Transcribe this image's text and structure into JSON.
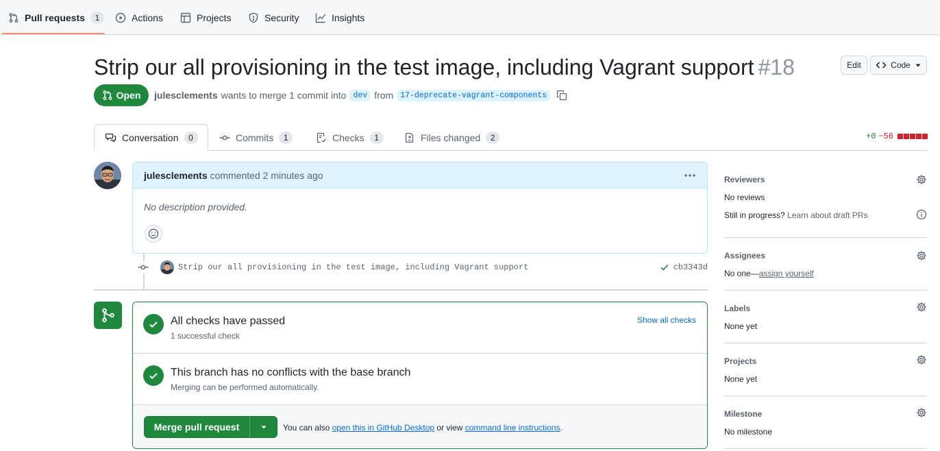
{
  "repo_nav": {
    "items": [
      {
        "label": "Pull requests",
        "count": "1"
      },
      {
        "label": "Actions"
      },
      {
        "label": "Projects"
      },
      {
        "label": "Security"
      },
      {
        "label": "Insights"
      }
    ]
  },
  "pr": {
    "title": "Strip our all provisioning in the test image, including Vagrant support",
    "number": "#18",
    "state": "Open",
    "author": "julesclements",
    "merge_text": "wants to merge 1 commit into",
    "base_branch": "dev",
    "from_text": "from",
    "head_branch": "17-deprecate-vagrant-components"
  },
  "header_buttons": {
    "edit": "Edit",
    "code": "Code"
  },
  "tabs": [
    {
      "label": "Conversation",
      "count": "0"
    },
    {
      "label": "Commits",
      "count": "1"
    },
    {
      "label": "Checks",
      "count": "1"
    },
    {
      "label": "Files changed",
      "count": "2"
    }
  ],
  "diffstat": {
    "additions": "+0",
    "deletions": "−56"
  },
  "comment": {
    "author": "julesclements",
    "action": "commented 2 minutes ago",
    "body": "No description provided."
  },
  "commit": {
    "message": "Strip our all provisioning in the test image, including Vagrant support",
    "sha": "cb3343d"
  },
  "merge_box": {
    "checks_title": "All checks have passed",
    "checks_sub": "1 successful check",
    "show_checks": "Show all checks",
    "conflicts_title": "This branch has no conflicts with the base branch",
    "conflicts_sub": "Merging can be performed automatically.",
    "merge_button": "Merge pull request",
    "alt_prefix": "You can also",
    "alt_desktop": "open this in GitHub Desktop",
    "alt_middle": "or view",
    "alt_cli": "command line instructions",
    "alt_suffix": "."
  },
  "sidebar": {
    "reviewers": {
      "heading": "Reviewers",
      "value": "No reviews",
      "draft_q": "Still in progress?",
      "draft_link": "Learn about draft PRs"
    },
    "assignees": {
      "heading": "Assignees",
      "value": "No one—",
      "assign_link": "assign yourself"
    },
    "labels": {
      "heading": "Labels",
      "value": "None yet"
    },
    "projects": {
      "heading": "Projects",
      "value": "None yet"
    },
    "milestone": {
      "heading": "Milestone",
      "value": "No milestone"
    }
  },
  "colors": {
    "accent": "#1f883d",
    "link": "#0969da",
    "danger": "#cf222e",
    "underline": "#fd8c73"
  }
}
